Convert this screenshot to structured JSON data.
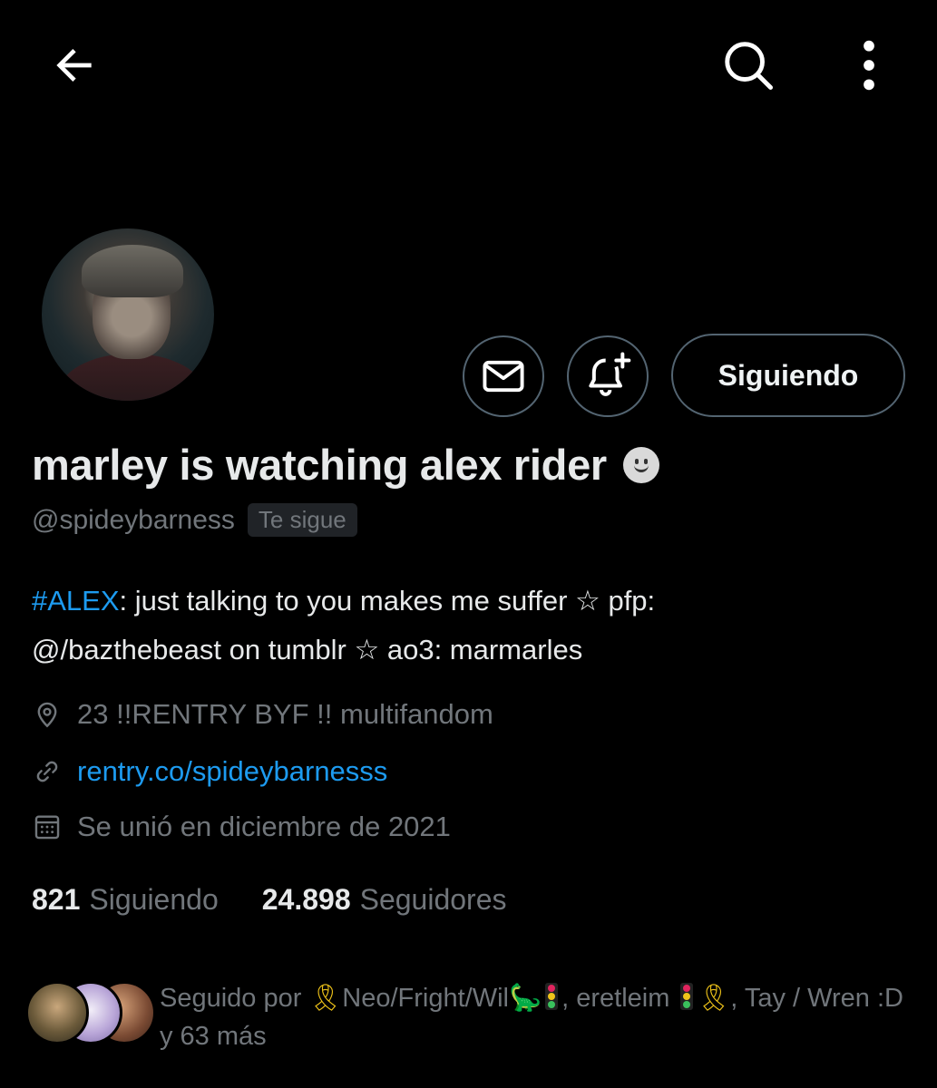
{
  "topbar": {
    "back_icon": "arrow-left-icon",
    "search_icon": "search-icon",
    "more_icon": "more-vertical-icon"
  },
  "profile": {
    "display_name": "marley is watching alex rider",
    "name_emoji": "slightly-smiling-face-emoji",
    "handle": "@spideybarness",
    "follows_you_badge": "Te sigue",
    "bio_hashtag": "#ALEX",
    "bio_line1_rest": ": just talking to you makes me suffer ☆ pfp:",
    "bio_line2": "@/bazthebeast on tumblr ☆ ao3: marmarles",
    "location": "23 !!RENTRY BYF !! multifandom",
    "website": "rentry.co/spideybarnesss",
    "joined": "Se unió en diciembre de 2021"
  },
  "actions": {
    "message_icon": "envelope-icon",
    "notify_icon": "bell-plus-icon",
    "follow_button_label": "Siguiendo"
  },
  "stats": {
    "following_count": "821",
    "following_label": "Siguiendo",
    "followers_count": "24.898",
    "followers_label": "Seguidores"
  },
  "followed_by": {
    "prefix": "Seguido por ",
    "name1": "Neo/Fright/Wil",
    "name2": ", eretleim ",
    "name3": ", Tay / Wren :D y 63 más"
  },
  "colors": {
    "background": "#000000",
    "primary_text": "#e7e9ea",
    "secondary_text": "#71767b",
    "link": "#1d9bf0",
    "border": "#536471"
  }
}
